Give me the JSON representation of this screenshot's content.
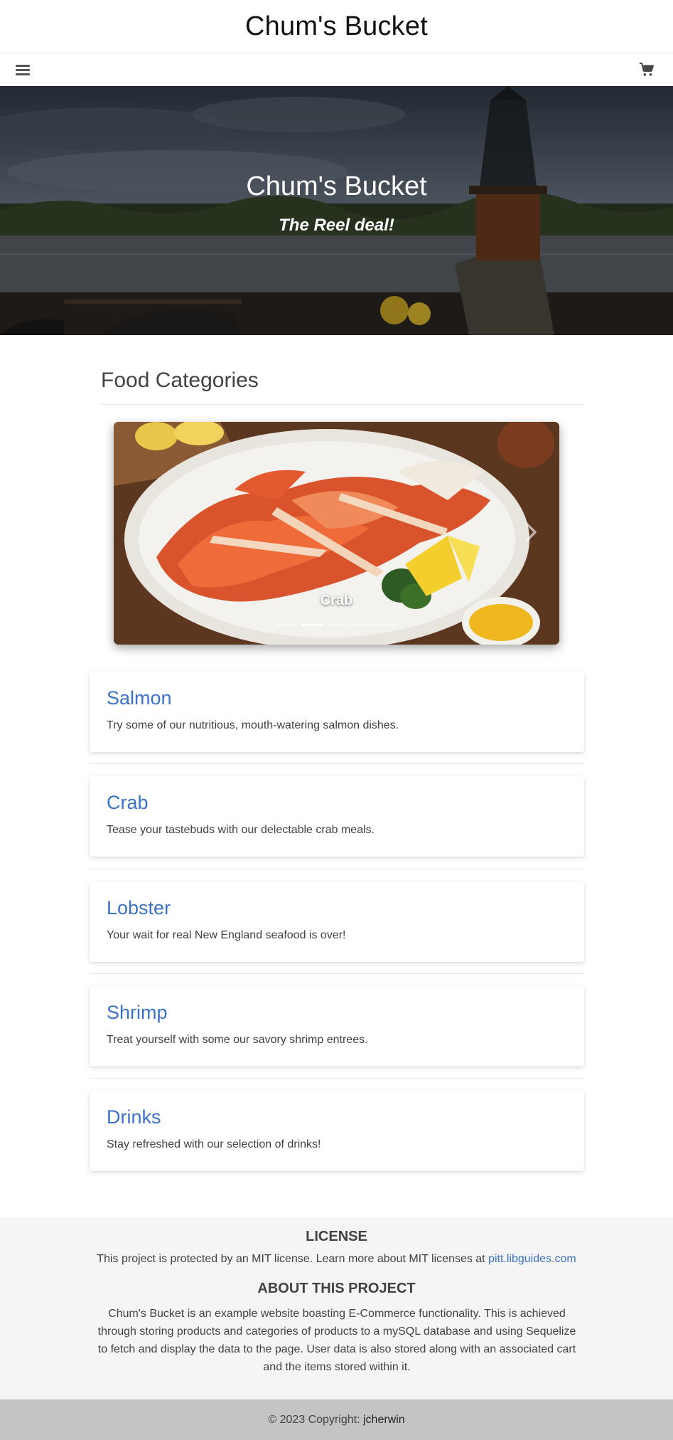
{
  "header": {
    "title": "Chum's Bucket"
  },
  "navbar": {
    "menu_icon": "hamburger-menu-icon",
    "cart_icon": "shopping-cart-icon"
  },
  "hero": {
    "title": "Chum's Bucket",
    "tagline": "The Reel deal!"
  },
  "categories_section": {
    "title": "Food Categories"
  },
  "carousel": {
    "caption": "Crab",
    "slide_count": 5,
    "active_index": 1,
    "next_icon": "chevron-right-icon"
  },
  "categories": [
    {
      "name": "Salmon",
      "description": "Try some of our nutritious, mouth-watering salmon dishes."
    },
    {
      "name": "Crab",
      "description": "Tease your tastebuds with our delectable crab meals."
    },
    {
      "name": "Lobster",
      "description": "Your wait for real New England seafood is over!"
    },
    {
      "name": "Shrimp",
      "description": "Treat yourself with some our savory shrimp entrees."
    },
    {
      "name": "Drinks",
      "description": "Stay refreshed with our selection of drinks!"
    }
  ],
  "footer": {
    "license_heading": "LICENSE",
    "license_text": "This project is protected by an MIT license. Learn more about MIT licenses at",
    "license_link": "pitt.libguides.com",
    "about_heading": "ABOUT THIS PROJECT",
    "about_text": "Chum's Bucket is an example website boasting E-Commerce functionality. This is achieved through storing products and categories of products to a mySQL database and using Sequelize to fetch and display the data to the page. User data is also stored along with an associated cart and the items stored within it.",
    "copyright_prefix": "© 2023 Copyright:",
    "copyright_name": "jcherwin"
  },
  "colors": {
    "link": "#3a72c8",
    "footer_bg": "#f5f5f5",
    "copyright_bg": "#c4c4c4"
  }
}
